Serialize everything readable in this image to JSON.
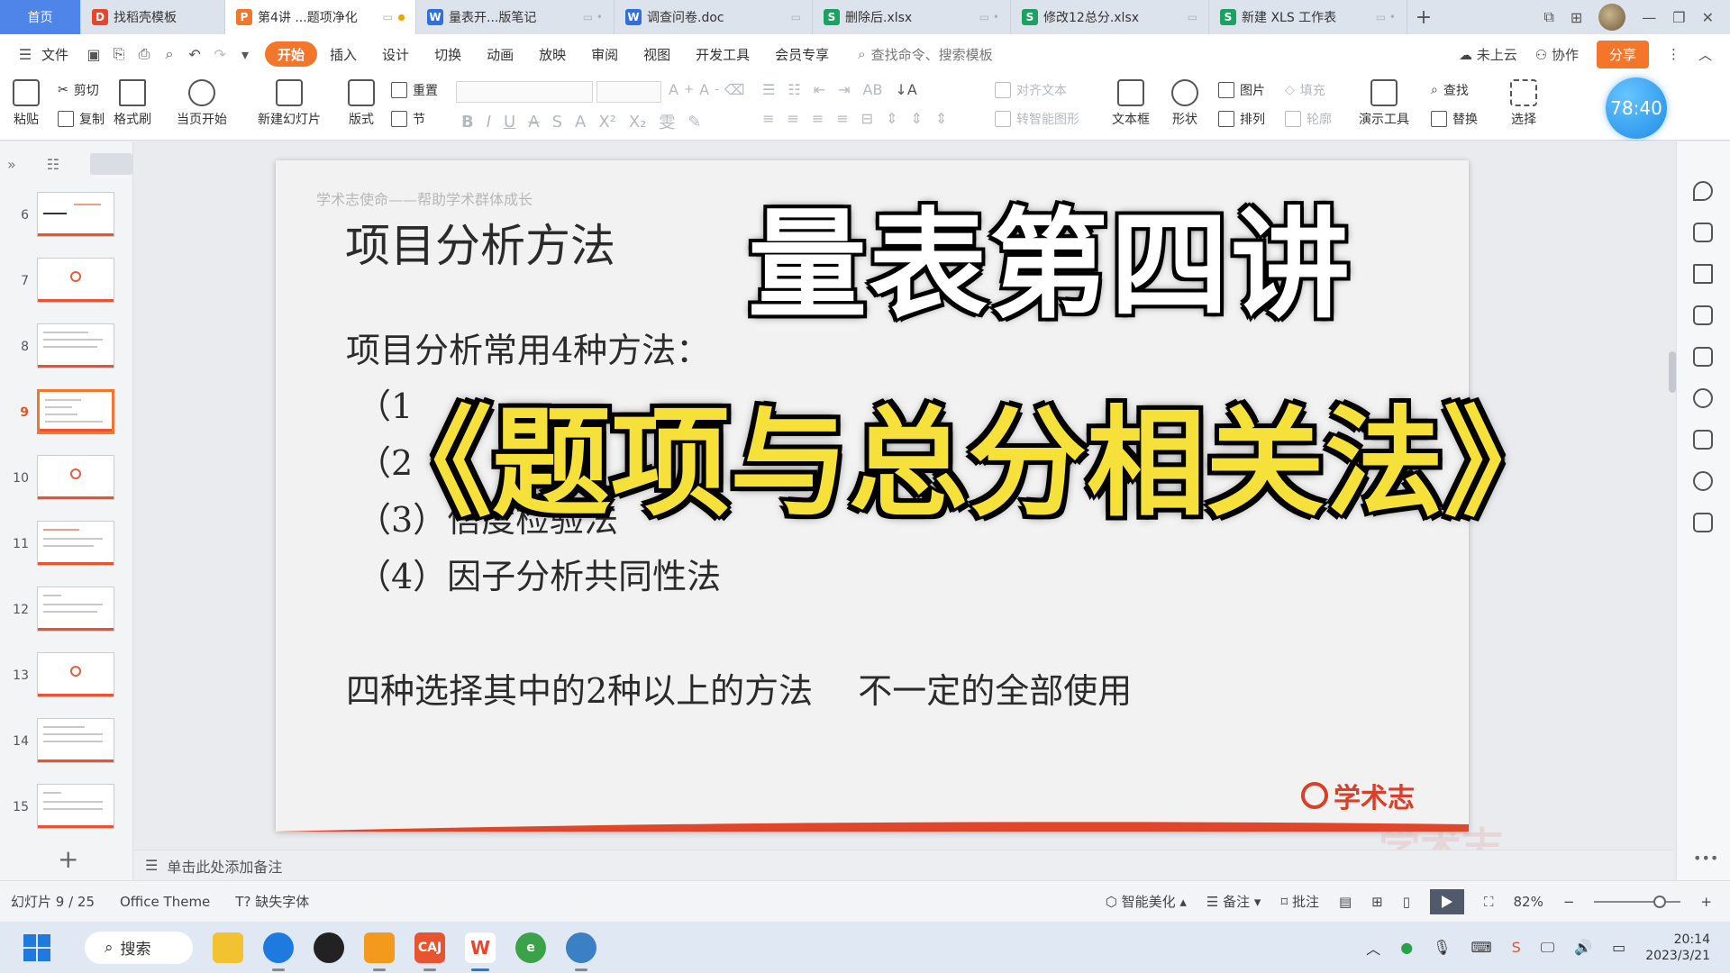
{
  "tabs": {
    "home": "首页",
    "items": [
      {
        "label": "找稻壳模板",
        "icon": "D",
        "color": "#e8452c"
      },
      {
        "label": "第4讲 ...题项净化",
        "icon": "P",
        "color": "#f4762b",
        "active": true
      },
      {
        "label": "量表开...版笔记",
        "icon": "W",
        "color": "#2f6fe0"
      },
      {
        "label": "调查问卷.doc",
        "icon": "W",
        "color": "#2f6fe0"
      },
      {
        "label": "删除后.xlsx",
        "icon": "S",
        "color": "#1aa260"
      },
      {
        "label": "修改12总分.xlsx",
        "icon": "S",
        "color": "#1aa260"
      },
      {
        "label": "新建 XLS 工作表",
        "icon": "S",
        "color": "#1aa260"
      }
    ],
    "add": "+"
  },
  "menu": {
    "file": "文件",
    "items": [
      "开始",
      "插入",
      "设计",
      "切换",
      "动画",
      "放映",
      "审阅",
      "视图",
      "开发工具",
      "会员专享"
    ],
    "search": "查找命令、搜索模板",
    "cloud": "未上云",
    "collab": "协作",
    "share": "分享"
  },
  "ribbon": {
    "paste": "粘贴",
    "cut": "剪切",
    "copy": "复制",
    "format_painter": "格式刷",
    "play_current": "当页开始",
    "new_slide": "新建幻灯片",
    "layout": "版式",
    "section": "节",
    "reset": "重置",
    "align_text": "对齐文本",
    "to_smartart": "转智能图形",
    "textbox": "文本框",
    "shape": "形状",
    "picture": "图片",
    "arrange": "排列",
    "fill": "填充",
    "outline": "轮廓",
    "presenter_tools": "演示工具",
    "find": "查找",
    "replace": "替换",
    "select": "选择"
  },
  "timer": "78:40",
  "slides_pane": {
    "thumbs": [
      {
        "num": "6"
      },
      {
        "num": "7"
      },
      {
        "num": "8"
      },
      {
        "num": "9",
        "selected": true
      },
      {
        "num": "10"
      },
      {
        "num": "11"
      },
      {
        "num": "12"
      },
      {
        "num": "13"
      },
      {
        "num": "14"
      },
      {
        "num": "15"
      }
    ],
    "add": "+"
  },
  "slide": {
    "header": "学术志使命——帮助学术群体成长",
    "title": "项目分析方法",
    "intro": "项目分析常用4种方法：",
    "item1": "（1",
    "item2": "（2",
    "item3": "（3）信度检验法",
    "item4": "（4）因子分析共同性法",
    "note": "四种选择其中的2种以上的方法　 不一定的全部使用",
    "brand": "学术志"
  },
  "overlay": {
    "line1": "量表第四讲",
    "line2": "《题项与总分相关法》"
  },
  "watermark": "学术志",
  "notes_placeholder": "单击此处添加备注",
  "status": {
    "slide_counter": "幻灯片 9 / 25",
    "theme": "Office Theme",
    "missing_fonts": "缺失字体",
    "beautify": "智能美化",
    "notes": "备注",
    "comments": "批注",
    "zoom": "82%"
  },
  "taskbar": {
    "search": "搜索",
    "time": "20:14",
    "date": "2023/3/21"
  }
}
